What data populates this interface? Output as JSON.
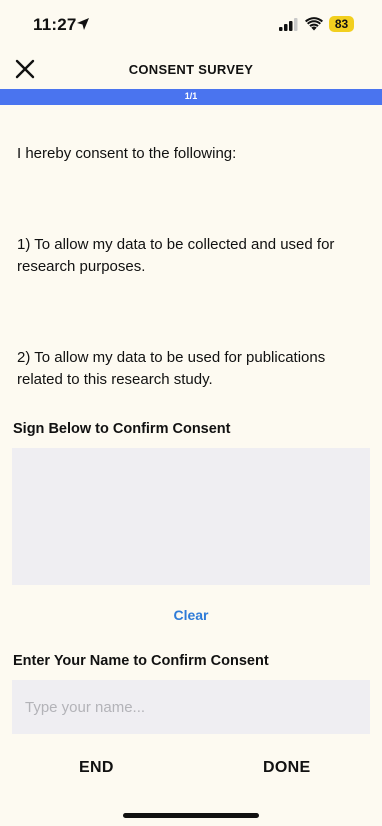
{
  "status_bar": {
    "time": "11:27",
    "battery_level": "83",
    "battery_color": "#f2cf1f"
  },
  "header": {
    "title": "CONSENT SURVEY",
    "close_icon": "close-icon"
  },
  "progress": {
    "label": "1/1",
    "fraction": 1.0,
    "fill_color": "#4a74ef"
  },
  "content": {
    "intro": "I hereby consent to the following:",
    "item_1": "1) To allow my data to be collected and used for research purposes.",
    "item_2": "2) To allow my data to be used for publications related to this research study."
  },
  "signature": {
    "label": "Sign Below to Confirm Consent",
    "clear_label": "Clear"
  },
  "name_section": {
    "label": "Enter Your Name to Confirm Consent",
    "placeholder": "Type your name...",
    "value": ""
  },
  "footer": {
    "end_label": "END",
    "done_label": "DONE"
  },
  "colors": {
    "background": "#fdfaf1",
    "accent": "#2e7bd8"
  }
}
